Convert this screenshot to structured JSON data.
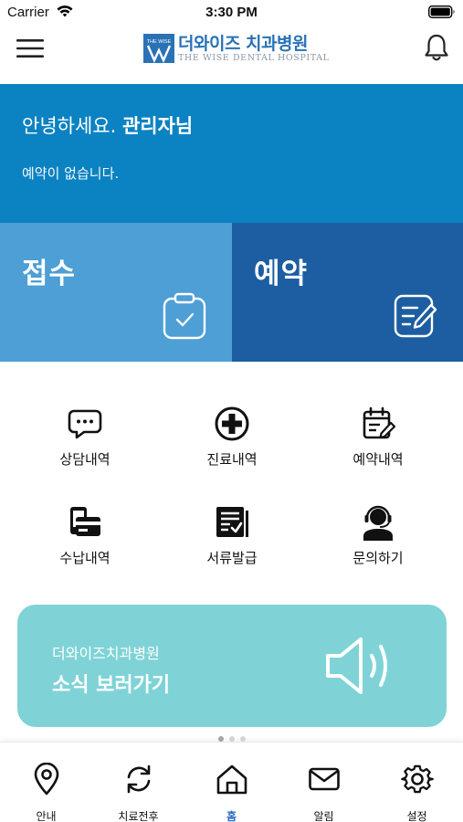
{
  "status_bar": {
    "carrier": "Carrier",
    "time": "3:30 PM"
  },
  "header": {
    "logo_ko": "더와이즈 치과병원",
    "logo_en": "THE WISE DENTAL HOSPITAL",
    "logo_mark_text": "THE WISE"
  },
  "hero": {
    "greeting_prefix": "안녕하세요.",
    "user_name": "관리자님",
    "message": "예약이 없습니다."
  },
  "tiles": {
    "reception": "접수",
    "reservation": "예약"
  },
  "menu": [
    {
      "label": "상담내역",
      "icon": "chat-bubble-icon"
    },
    {
      "label": "진료내역",
      "icon": "medical-cross-icon"
    },
    {
      "label": "예약내역",
      "icon": "calendar-edit-icon"
    },
    {
      "label": "수납내역",
      "icon": "payment-card-icon"
    },
    {
      "label": "서류발급",
      "icon": "document-check-icon"
    },
    {
      "label": "문의하기",
      "icon": "headset-agent-icon"
    }
  ],
  "news": {
    "subtitle": "더와이즈치과병원",
    "title": "소식 보러가기"
  },
  "tabs": [
    {
      "label": "안내",
      "icon": "location-pin-icon"
    },
    {
      "label": "치료전후",
      "icon": "refresh-icon"
    },
    {
      "label": "홈",
      "icon": "home-icon",
      "active": true
    },
    {
      "label": "알림",
      "icon": "mail-icon"
    },
    {
      "label": "설정",
      "icon": "gear-icon"
    }
  ],
  "colors": {
    "hero": "#0b82c1",
    "reception_tile": "#4d9fd5",
    "reservation_tile": "#1c5ea1",
    "news_banner": "#7fd3d7",
    "active_tab": "#2c6dc4"
  }
}
